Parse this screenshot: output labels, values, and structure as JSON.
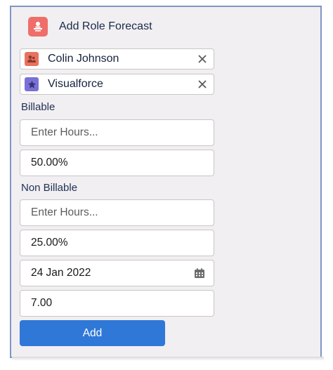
{
  "header": {
    "title": "Add Role Forecast",
    "icon": "forecast-icon",
    "icon_color": "#ef6e6a"
  },
  "selections": [
    {
      "label": "Colin Johnson",
      "icon": "user-icon",
      "icon_color": "#e8725f"
    },
    {
      "label": "Visualforce",
      "icon": "star-icon",
      "icon_color": "#7a70d8"
    }
  ],
  "billable": {
    "label": "Billable",
    "hours_placeholder": "Enter Hours...",
    "percent_value": "50.00%"
  },
  "non_billable": {
    "label": "Non Billable",
    "hours_placeholder": "Enter Hours...",
    "percent_value": "25.00%"
  },
  "date": {
    "value": "24 Jan 2022",
    "icon": "calendar-icon"
  },
  "hours_total": {
    "value": "7.00"
  },
  "actions": {
    "add_label": "Add",
    "accent": "#2f78d8"
  }
}
